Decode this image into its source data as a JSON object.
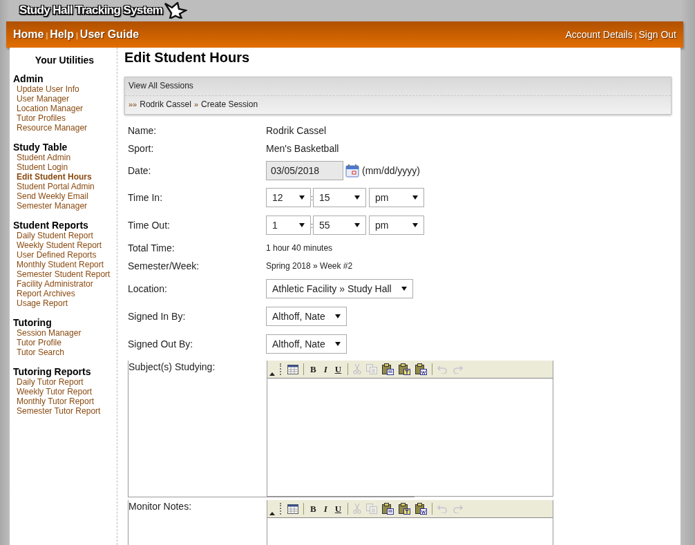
{
  "logo": {
    "text": "Study Hall Tracking System"
  },
  "nav": {
    "separator": "|",
    "left": [
      "Home",
      "Help",
      "User Guide"
    ],
    "right": [
      "Account Details",
      "Sign Out"
    ]
  },
  "sidebar": {
    "title": "Your Utilities",
    "groups": [
      {
        "heading": "Admin",
        "items": [
          {
            "label": "Update User Info",
            "selected": false
          },
          {
            "label": "User Manager",
            "selected": false
          },
          {
            "label": "Location Manager",
            "selected": false
          },
          {
            "label": "Tutor Profiles",
            "selected": false
          },
          {
            "label": "Resource Manager",
            "selected": false
          }
        ]
      },
      {
        "heading": "Study Table",
        "items": [
          {
            "label": "Student Admin",
            "selected": false
          },
          {
            "label": "Student Login",
            "selected": false
          },
          {
            "label": "Edit Student Hours",
            "selected": true
          },
          {
            "label": "Student Portal Admin",
            "selected": false
          },
          {
            "label": "Send Weekly Email",
            "selected": false
          },
          {
            "label": "Semester Manager",
            "selected": false
          }
        ]
      },
      {
        "heading": "Student Reports",
        "items": [
          {
            "label": "Daily Student Report",
            "selected": false
          },
          {
            "label": "Weekly Student Report",
            "selected": false
          },
          {
            "label": "User Defined Reports",
            "selected": false
          },
          {
            "label": "Monthly Student Report",
            "selected": false
          },
          {
            "label": "Semester Student Report",
            "selected": false
          },
          {
            "label": "Facility Administrator",
            "selected": false
          },
          {
            "label": "Report Archives",
            "selected": false
          },
          {
            "label": "Usage Report",
            "selected": false
          }
        ]
      },
      {
        "heading": "Tutoring",
        "items": [
          {
            "label": "Session Manager",
            "selected": false
          },
          {
            "label": "Tutor Profile",
            "selected": false
          },
          {
            "label": "Tutor Search",
            "selected": false
          }
        ]
      },
      {
        "heading": "Tutoring Reports",
        "items": [
          {
            "label": "Daily Tutor Report",
            "selected": false
          },
          {
            "label": "Weekly Tutor Report",
            "selected": false
          },
          {
            "label": "Monthly Tutor Report",
            "selected": false
          },
          {
            "label": "Semester Tutor Report",
            "selected": false
          }
        ]
      }
    ]
  },
  "page_title": "Edit Student Hours",
  "session_box": {
    "link": "View All Sessions",
    "breadcrumb": {
      "lead": "»»",
      "separator": "»",
      "items": [
        "Rodrik Cassel",
        "Create Session"
      ]
    }
  },
  "form": [
    {
      "kind": "text",
      "label": "Name:",
      "value": "Rodrik Cassel"
    },
    {
      "kind": "text",
      "label": "Sport:",
      "value": "Men's Basketball"
    },
    {
      "kind": "date",
      "label": "Date:",
      "value": "03/05/2018",
      "hint": "(mm/dd/yyyy)"
    },
    {
      "kind": "time",
      "label": "Time In:",
      "hour": "12",
      "minute": "15",
      "ampm": "pm",
      "separator": ":"
    },
    {
      "kind": "time",
      "label": "Time Out:",
      "hour": "1",
      "minute": "55",
      "ampm": "pm",
      "separator": ":"
    },
    {
      "kind": "small",
      "label": "Total Time:",
      "value": "1 hour 40 minutes"
    },
    {
      "kind": "small",
      "label": "Semester/Week:",
      "value": "Spring 2018 » Week #2"
    },
    {
      "kind": "select",
      "label": "Location:",
      "value": "Athletic Facility » Study Hall"
    },
    {
      "kind": "select",
      "label": "Signed In By:",
      "value": "Althoff, Nate"
    },
    {
      "kind": "select",
      "label": "Signed Out By:",
      "value": "Althoff, Nate"
    },
    {
      "kind": "editor",
      "label": "Subject(s) Studying:",
      "toolbar": [
        {
          "kind": "table",
          "disabled": false
        },
        {
          "kind": "sep"
        },
        {
          "kind": "bold",
          "label": "B",
          "disabled": false
        },
        {
          "kind": "italic",
          "label": "I",
          "disabled": false
        },
        {
          "kind": "underline",
          "label": "U",
          "disabled": false
        },
        {
          "kind": "sep"
        },
        {
          "kind": "cut",
          "disabled": true
        },
        {
          "kind": "copy",
          "disabled": true
        },
        {
          "kind": "paste",
          "disabled": false
        },
        {
          "kind": "paste-text",
          "disabled": false
        },
        {
          "kind": "paste-word",
          "disabled": false
        },
        {
          "kind": "sep"
        },
        {
          "kind": "undo",
          "disabled": true
        },
        {
          "kind": "redo",
          "disabled": true
        }
      ]
    },
    {
      "kind": "editor",
      "label": "Monitor Notes:",
      "toolbar": [
        {
          "kind": "table",
          "disabled": false
        },
        {
          "kind": "sep"
        },
        {
          "kind": "bold",
          "label": "B",
          "disabled": false
        },
        {
          "kind": "italic",
          "label": "I",
          "disabled": false
        },
        {
          "kind": "underline",
          "label": "U",
          "disabled": false
        },
        {
          "kind": "sep"
        },
        {
          "kind": "cut",
          "disabled": true
        },
        {
          "kind": "copy",
          "disabled": true
        },
        {
          "kind": "paste",
          "disabled": false
        },
        {
          "kind": "paste-text",
          "disabled": false
        },
        {
          "kind": "paste-word",
          "disabled": false
        },
        {
          "kind": "sep"
        },
        {
          "kind": "undo",
          "disabled": true
        },
        {
          "kind": "redo",
          "disabled": true
        }
      ]
    }
  ]
}
